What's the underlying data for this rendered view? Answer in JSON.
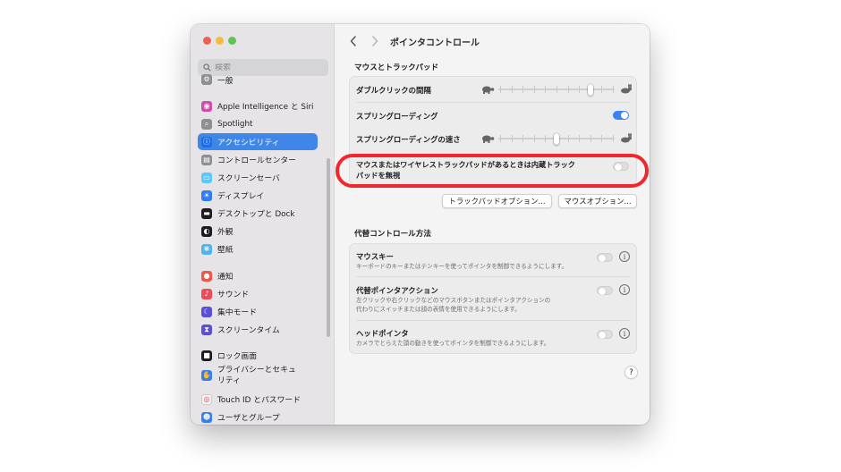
{
  "window": {
    "traffic_colors": [
      "#ee5f57",
      "#f6bd3b",
      "#5fc453"
    ]
  },
  "sidebar": {
    "search_placeholder": "検索",
    "items": [
      {
        "label": "一般",
        "icon": "gear-icon",
        "color": "#8e8e93"
      },
      {
        "label": "Apple Intelligence と Siri",
        "icon": "siri-icon",
        "color": "#d54ca8"
      },
      {
        "label": "Spotlight",
        "icon": "search-icon",
        "color": "#8e8e93"
      },
      {
        "label": "アクセシビリティ",
        "icon": "accessibility-icon",
        "color": "#1f6de6",
        "active": true
      },
      {
        "label": "コントロールセンター",
        "icon": "control-center-icon",
        "color": "#8e8e93"
      },
      {
        "label": "スクリーンセーバ",
        "icon": "screensaver-icon",
        "color": "#5ac8fa"
      },
      {
        "label": "ディスプレイ",
        "icon": "sun-icon",
        "color": "#2e7cf6"
      },
      {
        "label": "デスクトップと Dock",
        "icon": "dock-icon",
        "color": "#1c1c1e"
      },
      {
        "label": "外観",
        "icon": "appearance-icon",
        "color": "#1c1c1e"
      },
      {
        "label": "壁紙",
        "icon": "wallpaper-icon",
        "color": "#4fb4f0"
      },
      {
        "label": "通知",
        "icon": "bell-icon",
        "color": "#f2564b"
      },
      {
        "label": "サウンド",
        "icon": "speaker-icon",
        "color": "#ef4a5a"
      },
      {
        "label": "集中モード",
        "icon": "moon-icon",
        "color": "#5a4fd6"
      },
      {
        "label": "スクリーンタイム",
        "icon": "hourglass-icon",
        "color": "#5a4fd6"
      },
      {
        "label": "ロック画面",
        "icon": "lock-icon",
        "color": "#1c1c1e"
      },
      {
        "label": "プライバシーとセキュリティ",
        "icon": "hand-icon",
        "color": "#3a7df0"
      },
      {
        "label": "Touch ID とパスワード",
        "icon": "fingerprint-icon",
        "color": "#f2f2f2"
      },
      {
        "label": "ユーザとグループ",
        "icon": "users-icon",
        "color": "#3a7df0"
      }
    ]
  },
  "main": {
    "title": "ポインタコントロール",
    "section1": {
      "title": "マウスとトラックパッド",
      "double_click": {
        "label": "ダブルクリックの間隔",
        "value": 0.8
      },
      "spring_loading": {
        "label": "スプリングローディング",
        "on": true
      },
      "spring_speed": {
        "label": "スプリングローディングの速さ",
        "value": 0.5
      },
      "ignore_trackpad": {
        "label_line1": "マウスまたはワイヤレストラックパッドがあるときは内蔵トラック",
        "label_line2": "パッドを無視",
        "on": false
      },
      "trackpad_options_button": "トラックパッドオプション...",
      "mouse_options_button": "マウスオプション..."
    },
    "section2": {
      "title": "代替コントロール方法",
      "mouse_keys": {
        "label": "マウスキー",
        "desc": "キーボードのキーまたはテンキーを使ってポインタを制御できるようにします。",
        "on": false
      },
      "alt_pointer": {
        "label": "代替ポインタアクション",
        "desc_line1": "左クリックや右クリックなどのマウスボタンまたはポインタアクションの",
        "desc_line2": "代わりにスイッチまたは顔の表情を使用できるようにします。",
        "on": false
      },
      "head_pointer": {
        "label": "ヘッドポインタ",
        "desc": "カメラでとらえた頭の動きを使ってポインタを制御できるようにします。",
        "on": false
      }
    },
    "help_label": "?"
  },
  "annotation": {
    "color": "#f2272b"
  }
}
